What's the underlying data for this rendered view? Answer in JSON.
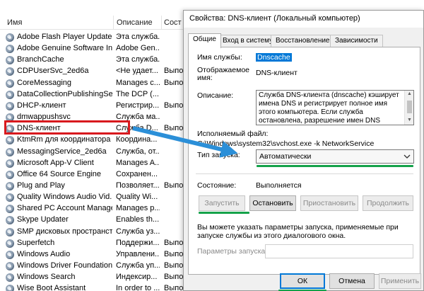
{
  "services": {
    "columns": {
      "name": "Имя",
      "description": "Описание",
      "status": "Сост"
    },
    "rows": [
      {
        "name": "Adobe Flash Player Update ...",
        "description": "Эта служба...",
        "status": ""
      },
      {
        "name": "Adobe Genuine Software In...",
        "description": "Adobe Gen...",
        "status": ""
      },
      {
        "name": "BranchCache",
        "description": "Эта служба...",
        "status": ""
      },
      {
        "name": "CDPUserSvc_2ed6a",
        "description": "<Не удает...",
        "status": "Выпо"
      },
      {
        "name": "CoreMessaging",
        "description": "Manages c...",
        "status": "Выпо"
      },
      {
        "name": "DataCollectionPublishingSe...",
        "description": "The DCP (...",
        "status": ""
      },
      {
        "name": "DHCP-клиент",
        "description": "Регистрир...",
        "status": "Выпо"
      },
      {
        "name": "dmwappushsvc",
        "description": "Служба ма...",
        "status": ""
      },
      {
        "name": "DNS-клиент",
        "description": "Служба D...",
        "status": "Выпо"
      },
      {
        "name": "KtmRm для координатора ...",
        "description": "Координа...",
        "status": ""
      },
      {
        "name": "MessagingService_2ed6a",
        "description": "Служба, от...",
        "status": ""
      },
      {
        "name": "Microsoft App-V Client",
        "description": "Manages A...",
        "status": ""
      },
      {
        "name": "Office 64 Source Engine",
        "description": "Сохранен...",
        "status": ""
      },
      {
        "name": "Plug and Play",
        "description": "Позволяет...",
        "status": "Выпо"
      },
      {
        "name": "Quality Windows Audio Vid...",
        "description": "Quality Wi...",
        "status": ""
      },
      {
        "name": "Shared PC Account Manager",
        "description": "Manages p...",
        "status": ""
      },
      {
        "name": "Skype Updater",
        "description": "Enables th...",
        "status": ""
      },
      {
        "name": "SMP дисковых пространст...",
        "description": "Служба уз...",
        "status": ""
      },
      {
        "name": "Superfetch",
        "description": "Поддержи...",
        "status": "Выпо"
      },
      {
        "name": "Windows Audio",
        "description": "Управлени...",
        "status": "Выпо"
      },
      {
        "name": "Windows Driver Foundation...",
        "description": "Служба уп...",
        "status": "Выпо"
      },
      {
        "name": "Windows Search",
        "description": "Индексир...",
        "status": "Выпо"
      },
      {
        "name": "Wise Boot Assistant",
        "description": "In order to ...",
        "status": "Выпо"
      }
    ]
  },
  "dialog": {
    "title": "Свойства: DNS-клиент (Локальный компьютер)",
    "tabs": [
      "Общие",
      "Вход в систему",
      "Восстановление",
      "Зависимости"
    ],
    "service_name_label": "Имя службы:",
    "service_name_value": "Dnscache",
    "display_name_label": "Отображаемое имя:",
    "display_name_value": "DNS-клиент",
    "description_label": "Описание:",
    "description_value": "Служба DNS-клиента (dnscache) кэширует имена DNS и регистрирует полное имя этого компьютера. Если служба остановлена, разрешение имен DNS будет продолжаться, но",
    "exe_label": "Исполняемый файл:",
    "exe_value": "C:\\Windows\\system32\\svchost.exe -k NetworkService",
    "startup_label": "Тип запуска:",
    "startup_value": "Автоматически",
    "state_label": "Состояние:",
    "state_value": "Выполняется",
    "btn_start": "Запустить",
    "btn_stop": "Остановить",
    "btn_pause": "Приостановить",
    "btn_resume": "Продолжить",
    "note": "Вы можете указать параметры запуска, применяемые при запуске службы из этого диалогового окна.",
    "params_label": "Параметры запуска:",
    "params_value": "",
    "btn_ok": "ОК",
    "btn_cancel": "Отмена",
    "btn_apply": "Применить"
  },
  "colors": {
    "highlight_red": "#d8191e",
    "arrow_blue": "#2b8fd8",
    "underline_green": "#15a24a",
    "selection_blue": "#0078d7"
  },
  "icons": {
    "service": "gear-icon",
    "dropdown": "chevron-down-icon"
  }
}
